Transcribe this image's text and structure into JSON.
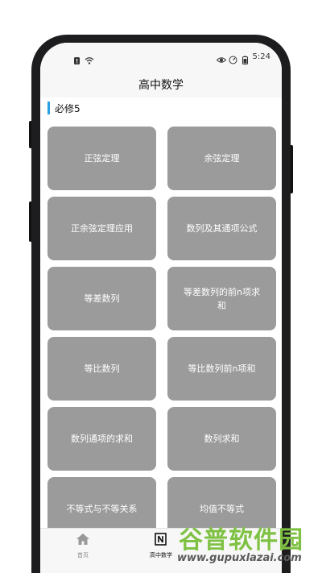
{
  "status_bar": {
    "time": "5:24",
    "left_icons": [
      "notification-icon",
      "wifi-icon"
    ],
    "right_icons": [
      "eye-icon",
      "speed-icon",
      "battery-icon"
    ]
  },
  "header": {
    "title": "高中数学"
  },
  "section": {
    "title": "必修5",
    "accent_color": "#2c9fe0"
  },
  "cards": [
    {
      "label": "正弦定理"
    },
    {
      "label": "余弦定理"
    },
    {
      "label": "正余弦定理应用"
    },
    {
      "label": "数列及其通项公式"
    },
    {
      "label": "等差数列"
    },
    {
      "label": "等差数列的前n项求和"
    },
    {
      "label": "等比数列"
    },
    {
      "label": "等比数列前n项和"
    },
    {
      "label": "数列通项的求和"
    },
    {
      "label": "数列求和"
    },
    {
      "label": "不等式与不等关系"
    },
    {
      "label": "均值不等式"
    }
  ],
  "tab_bar": {
    "tabs": [
      {
        "label": "首页",
        "icon": "home-icon",
        "active": false
      },
      {
        "label": "高中数学",
        "icon": "book-icon",
        "active": true
      }
    ]
  },
  "watermark": {
    "main": "谷普软件园",
    "sub": "www.gupuxlazai.com"
  },
  "colors": {
    "card": "#9b9b9b",
    "bar_bg": "#f7f7f7",
    "watermark": "#7fc243"
  }
}
